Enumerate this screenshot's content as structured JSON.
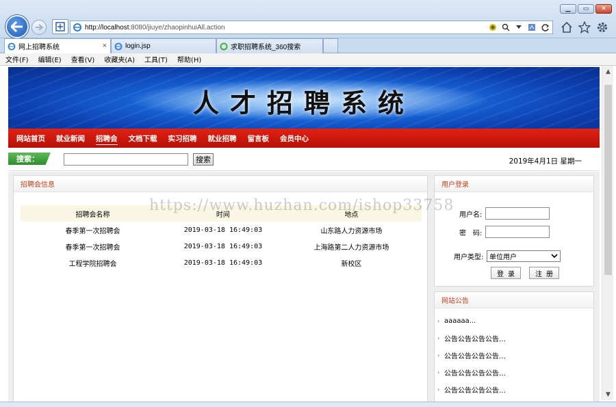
{
  "browser": {
    "url_host": "http://localhost",
    "url_rest": ":8080/jiuye/zhaopinhuiAll.action",
    "tabs": [
      {
        "label": "网上招聘系统",
        "close": "×"
      },
      {
        "label": "login.jsp"
      },
      {
        "label": "求职招聘系统_360搜索"
      }
    ],
    "menu": [
      "文件(F)",
      "编辑(E)",
      "查看(V)",
      "收藏夹(A)",
      "工具(T)",
      "帮助(H)"
    ]
  },
  "site": {
    "banner_title": "人才招聘系统",
    "nav": [
      "网站首页",
      "就业新闻",
      "招聘会",
      "文档下载",
      "实习招聘",
      "就业招聘",
      "留言板",
      "会员中心"
    ],
    "search_label": "搜索：",
    "search_button": "搜索",
    "search_value": "",
    "date": "2019年4月1日  星期一"
  },
  "job_panel": {
    "title": "招聘会信息",
    "headers": [
      "招聘会名称",
      "时间",
      "地点"
    ],
    "rows": [
      {
        "name": "春季第一次招聘会",
        "time": "2019-03-18 16:49:03",
        "place": "山东路人力资源市场"
      },
      {
        "name": "春季第一次招聘会",
        "time": "2019-03-18 16:49:03",
        "place": "上海路第二人力资源市场"
      },
      {
        "name": "工程学院招聘会",
        "time": "2019-03-18 16:49:03",
        "place": "新校区"
      }
    ]
  },
  "login_panel": {
    "title": "用户登录",
    "username_label": "用户名:",
    "password_label": "密　码:",
    "usertype_label": "用户类型:",
    "usertype_value": "单位用户",
    "login_button": "登录",
    "register_button": "注册"
  },
  "notice_panel": {
    "title": "网站公告",
    "items": [
      "aaaaaa...",
      "公告公告公告公告…",
      "公告公告公告公告…",
      "公告公告公告公告…",
      "公告公告公告公告…"
    ]
  },
  "watermark": "https://www.huzhan.com/ishop33758",
  "colors": {
    "nav_red": "#c8180b",
    "panel_title": "#c0401a",
    "banner_blue": "#1767d8",
    "search_green": "#3c9b38"
  }
}
